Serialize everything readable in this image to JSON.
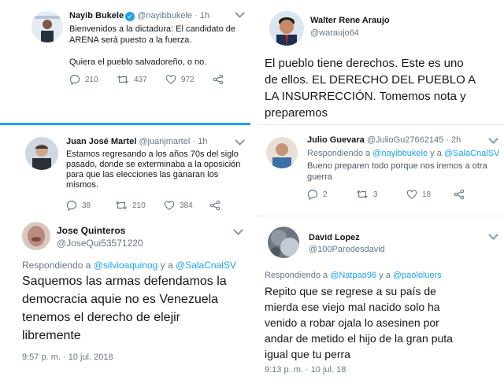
{
  "tweets": [
    {
      "name": "Nayib Bukele",
      "handle": "@nayibbukele",
      "time": "· 1h",
      "lines": [
        "Bienvenidos a la dictadura: El candidato de",
        "ARENA será puesto a la fuerza.",
        "",
        "Quiera el pueblo salvadoreño, o no."
      ],
      "replies": "210",
      "retweets": "437",
      "likes": "972"
    },
    {
      "name": "Walter Rene Araujo",
      "handle": "@waraujo64",
      "lines": [
        "El pueblo tiene derechos. Este es uno",
        "de ellos. EL DERECHO DEL PUEBLO A",
        "LA INSURRECCIÓN. Tomemos nota y",
        "preparemos"
      ]
    },
    {
      "name": "Juan José Martel",
      "handle": "@juanjmartel",
      "time": "· 1h",
      "lines": [
        "Estamos regresando a los años 70s del siglo",
        "pasado, donde se exterminaba a la oposición",
        "para que las elecciones las ganaran los",
        "mismos."
      ],
      "replies": "38",
      "retweets": "210",
      "likes": "384"
    },
    {
      "name": "Julio Guevara",
      "handle": "@JulioGu27662145",
      "time": "· 2h",
      "reply_prefix": "Respondiendo a",
      "reply_to_1": "@nayibbukele",
      "reply_join": "y a",
      "reply_to_2": "@SalaCnalSV",
      "lines": [
        "Bueno preparen todo porque nos iremos a otra",
        "guerra"
      ],
      "replies": "2",
      "retweets": "3",
      "likes": "18"
    },
    {
      "name": "Jose Quinteros",
      "handle": "@JoseQui53571220",
      "reply_prefix": "Respondiendo a",
      "reply_to_1": "@silvioaquinog",
      "reply_join": "y a",
      "reply_to_2": "@SalaCnalSV",
      "lines": [
        "Saquemos las armas defendamos la",
        "democracia aquie no es Venezuela",
        "tenemos el derecho de elejir",
        "libremente"
      ],
      "timestamp": "9:57 p. m. · 10 jul. 2018"
    },
    {
      "name": "David Lopez",
      "handle": "@100Paredesdavid",
      "reply_prefix": "Respondiendo a",
      "reply_to_1": "@Natpao96",
      "reply_join": "y a",
      "reply_to_2": "@paololuers",
      "lines": [
        "Repito que se regrese a su país de",
        "mierda ese viejo mal nacido solo ha",
        "venido a robar ojala lo asesinen por",
        "andar de metido el hijo de la gran puta",
        "igual que tu perra"
      ],
      "timestamp": "9:13 p. m. · 10 jul. 18"
    }
  ],
  "icons": {
    "reply": "reply-icon",
    "retweet": "retweet-icon",
    "like": "heart-icon",
    "share": "share-icon",
    "more": "chevron-down-icon",
    "verified": "verified-badge-icon"
  },
  "colors": {
    "link": "#1da1f2",
    "muted": "#657786",
    "text": "#14171a",
    "separator": "#e6ecf0",
    "blue_rule": "#1da1f2"
  }
}
